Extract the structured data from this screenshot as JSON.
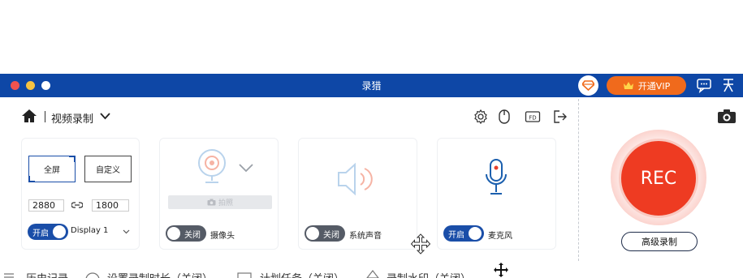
{
  "window": {
    "title": "录猎",
    "vip_label": "开通VIP",
    "colors": {
      "titlebar": "#0e47a6",
      "vip": "#f06a1c",
      "rec": "#ee3b22",
      "accent": "#1a4ea8"
    },
    "icons": [
      "close-dot",
      "minimize-dot",
      "maximize-dot",
      "diamond-icon",
      "crown-icon",
      "message-icon",
      "pin-icon"
    ]
  },
  "toolbar": {
    "mode_label": "视频录制",
    "icons": [
      "home-icon",
      "chevron-down-icon",
      "settings-icon",
      "mouse-icon",
      "fd-icon",
      "exit-icon",
      "camera-icon"
    ]
  },
  "screen_card": {
    "fullscreen_label": "全屏",
    "custom_label": "自定义",
    "width": "2880",
    "height": "1800",
    "toggle_label": "开启",
    "display_label": "Display 1"
  },
  "webcam_card": {
    "snapshot_label": "拍照",
    "toggle_label": "关闭",
    "caption": "摄像头"
  },
  "system_audio_card": {
    "toggle_label": "关闭",
    "caption": "系统声音"
  },
  "mic_card": {
    "toggle_label": "开启",
    "caption": "麦克风"
  },
  "record": {
    "rec_label": "REC",
    "advanced_label": "高级录制"
  },
  "bottom": {
    "items": [
      "历史记录",
      "设置录制时长（关闭）",
      "计划任务（关闭）",
      "录制水印（关闭）"
    ]
  }
}
